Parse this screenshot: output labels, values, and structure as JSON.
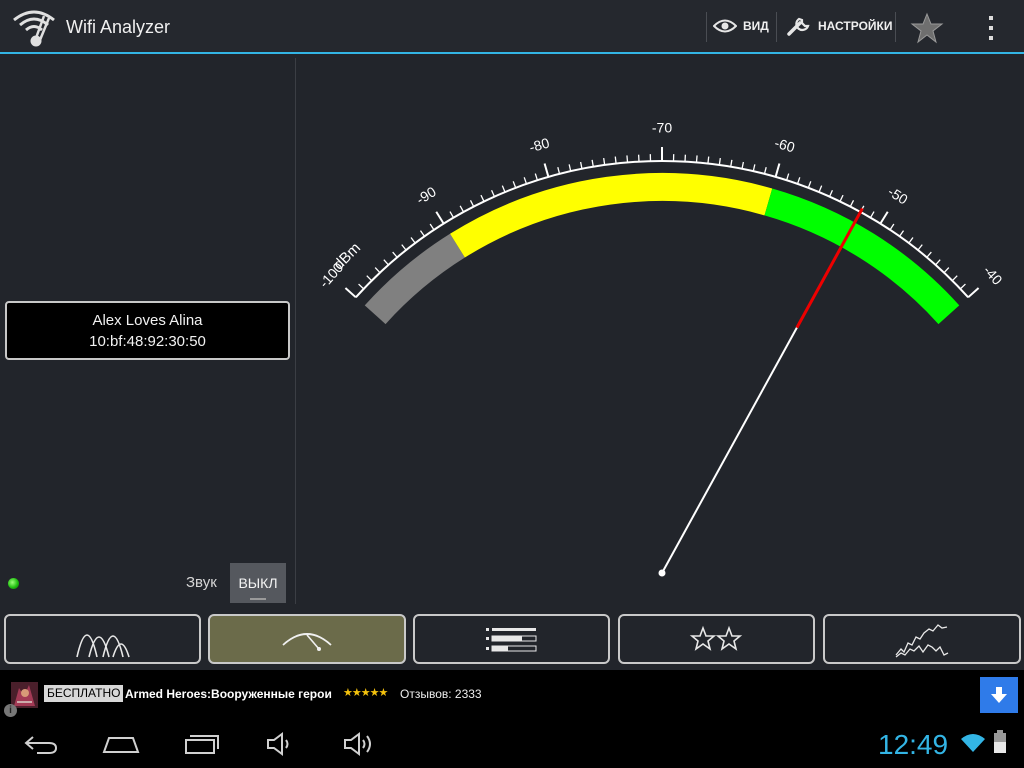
{
  "app": {
    "title": "Wifi Analyzer",
    "icon": "wifi-tuning-fork-icon"
  },
  "actionbar": {
    "view_label": "ВИД",
    "view_icon": "eye-icon",
    "settings_label": "НАСТРОЙКИ",
    "settings_icon": "wrench-icon",
    "favorite_icon": "star-icon",
    "overflow_icon": "overflow-menu-icon"
  },
  "network": {
    "ssid": "Alex Loves Alina",
    "bssid": "10:bf:48:92:30:50",
    "status_color": "#22cc11"
  },
  "sound": {
    "label": "Звук",
    "toggle_value": "ВЫКЛ"
  },
  "gauge": {
    "unit_label": "dBm",
    "scale_min": -100,
    "scale_max": -40,
    "major_ticks": [
      -100,
      -90,
      -80,
      -70,
      -60,
      -50,
      -40
    ],
    "tick_labels": [
      "-100",
      "-90",
      "-80",
      "-70",
      "-60",
      "-50",
      "-40"
    ],
    "signal_dbm": -52,
    "zones": [
      {
        "from": -100,
        "to": -90,
        "color": "#808080"
      },
      {
        "from": -90,
        "to": -60,
        "color": "#ffff00"
      },
      {
        "from": -60,
        "to": -40,
        "color": "#00ff00"
      }
    ],
    "needle_color": "#ffffff",
    "needle_tip_color": "#ee0000"
  },
  "tabs": [
    {
      "name": "tab-channel-graph",
      "icon": "channel-graph-icon",
      "active": false
    },
    {
      "name": "tab-signal-meter",
      "icon": "signal-meter-icon",
      "active": true
    },
    {
      "name": "tab-ap-list",
      "icon": "list-icon",
      "active": false
    },
    {
      "name": "tab-channel-rating",
      "icon": "rating-stars-icon",
      "active": false
    },
    {
      "name": "tab-time-graph",
      "icon": "time-graph-icon",
      "active": false
    }
  ],
  "ad": {
    "badge": "БЕСПЛАТНО",
    "title": "Armed Heroes:Вооруженные герои",
    "rating_stars": "★★★★★",
    "rating": 4.5,
    "reviews": "Отзывов: 2333",
    "info_icon": "i",
    "download_icon": "download-arrow-icon"
  },
  "system": {
    "clock": "12:49",
    "nav_icons": [
      "back-icon",
      "home-icon",
      "recent-apps-icon",
      "volume-down-icon",
      "volume-up-icon"
    ],
    "status_icons": [
      "wifi-status-icon",
      "battery-icon"
    ]
  }
}
